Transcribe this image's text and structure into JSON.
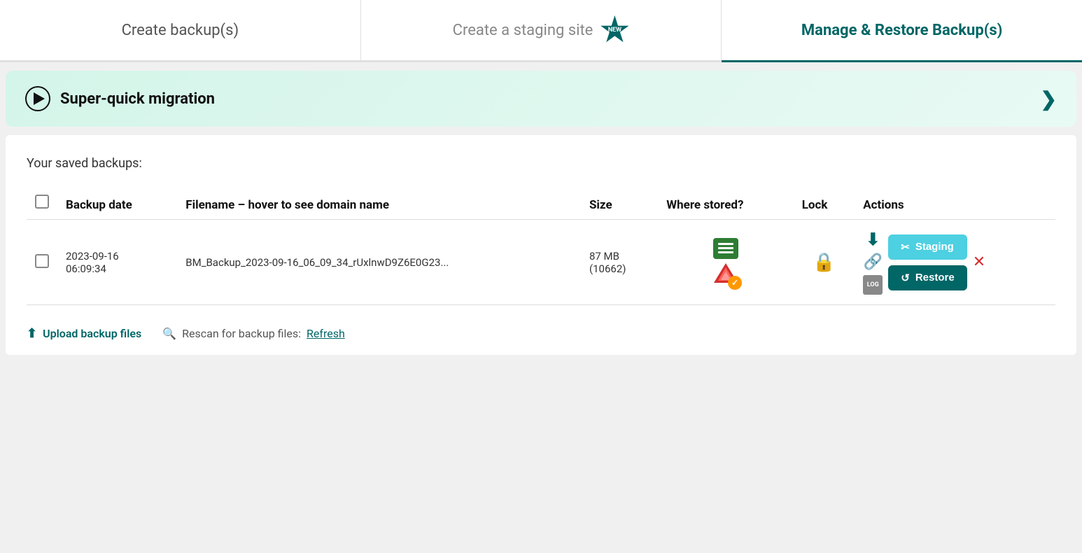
{
  "tabs": [
    {
      "id": "create-backups",
      "label": "Create backup(s)",
      "active": false
    },
    {
      "id": "create-staging",
      "label": "Create a staging site",
      "active": false,
      "badge": "NEW"
    },
    {
      "id": "manage-restore",
      "label": "Manage & Restore Backup(s)",
      "active": true
    }
  ],
  "migration_banner": {
    "title": "Super-quick migration",
    "chevron": "❯"
  },
  "backups_section": {
    "label": "Your saved backups:",
    "table": {
      "headers": [
        {
          "id": "checkbox",
          "label": ""
        },
        {
          "id": "backup-date",
          "label": "Backup date"
        },
        {
          "id": "filename",
          "label": "Filename – hover to see domain name"
        },
        {
          "id": "size",
          "label": "Size"
        },
        {
          "id": "where-stored",
          "label": "Where stored?"
        },
        {
          "id": "lock",
          "label": "Lock"
        },
        {
          "id": "actions",
          "label": "Actions"
        }
      ],
      "rows": [
        {
          "id": "row-1",
          "date": "2023-09-16\n06:09:34",
          "filename": "BM_Backup_2023-09-16_06_09_34_rUxlnwD9Z6E0G23...",
          "size": "87 MB\n(10662)",
          "has_db": true,
          "has_drive": true,
          "drive_verified": true,
          "locked": false,
          "staging_label": "Staging",
          "restore_label": "Restore"
        }
      ]
    }
  },
  "footer": {
    "upload_label": "Upload backup files",
    "rescan_label": "Rescan for backup files:",
    "refresh_label": "Refresh"
  },
  "icons": {
    "play": "▶",
    "chevron_down": "∨",
    "upload": "⬆",
    "search": "🔍",
    "download": "⬇",
    "link": "🔗",
    "log": "LOG",
    "lock": "🔒",
    "scissors": "✂",
    "refresh": "↺",
    "delete": "✕",
    "checkmark": "✓"
  }
}
